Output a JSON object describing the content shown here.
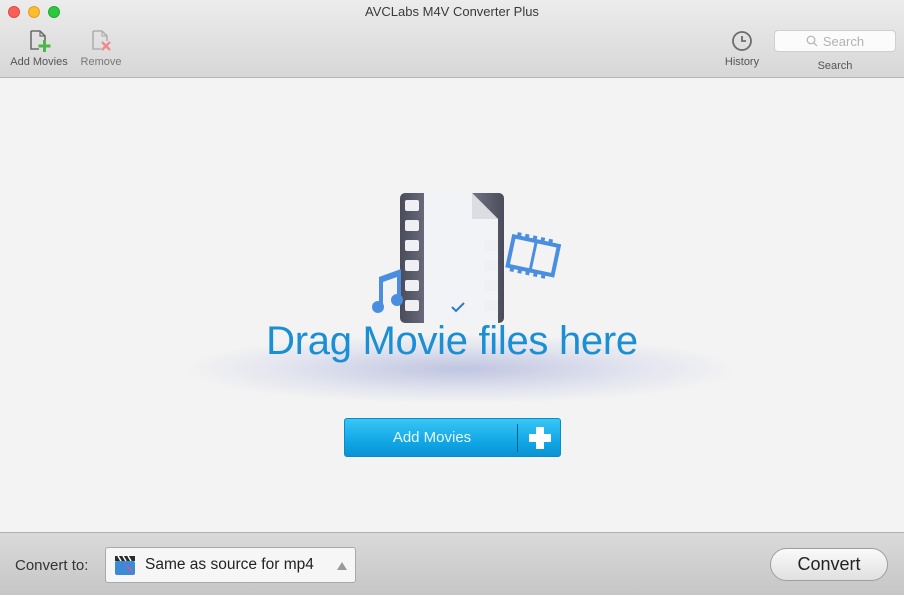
{
  "window": {
    "title": "AVCLabs M4V Converter Plus"
  },
  "toolbar": {
    "add_movies_label": "Add Movies",
    "remove_label": "Remove",
    "history_label": "History",
    "search_placeholder": "Search",
    "search_label": "Search",
    "icons": {
      "add": "add-file-plus-icon",
      "remove": "remove-file-x-icon",
      "history": "clock-icon",
      "search": "magnifier-icon"
    }
  },
  "main": {
    "drop_text": "Drag Movie files here",
    "add_button_label": "Add Movies",
    "illustration": "film-document-music-illustration",
    "accent_color": "#1a8fd4"
  },
  "bottom": {
    "convert_to_label": "Convert to:",
    "format_selected": "Same as source for mp4",
    "convert_button_label": "Convert"
  }
}
